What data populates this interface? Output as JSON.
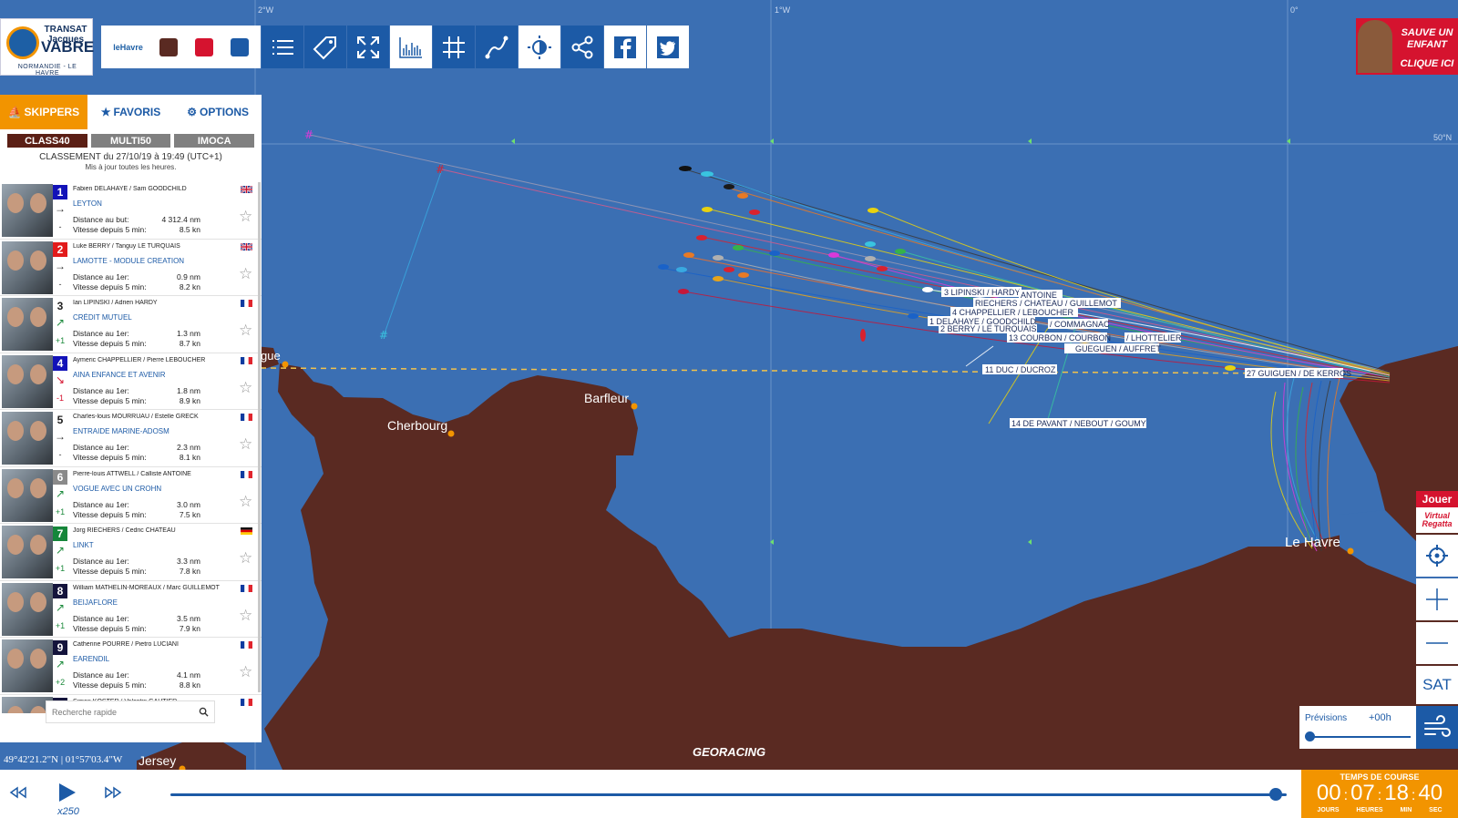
{
  "logo": {
    "line1": "TRANSAT Jacques",
    "line2": "VABRE",
    "line3": "NORMANDIE - LE HAVRE"
  },
  "partners": [
    "leHavre",
    "",
    "",
    ""
  ],
  "toolbar": [
    "list-icon",
    "tag-icon",
    "fullscreen-icon",
    "chart-icon",
    "grid-icon",
    "route-icon",
    "contrast-icon",
    "share-icon",
    "facebook-icon",
    "twitter-icon"
  ],
  "ad": {
    "line1": "SAUVE UN ENFANT",
    "line2": "CLIQUE ICI"
  },
  "panel": {
    "tabs": [
      "SKIPPERS",
      "FAVORIS",
      "OPTIONS"
    ],
    "classes": [
      "CLASS40",
      "MULTI50",
      "IMOCA"
    ],
    "ranking_title": "CLASSEMENT du 27/10/19 à 19:49 (UTC+1)",
    "ranking_sub": "Mis à jour toutes les heures.",
    "search_placeholder": "Recherche rapide"
  },
  "skippers": [
    {
      "rank": "1",
      "color": "#1212b8",
      "trend": "→",
      "delta": "-",
      "names": "Fabien DELAHAYE / Sam GOODCHILD",
      "boat": "LEYTON",
      "l1": "Distance au but:",
      "v1": "4 312.4 nm",
      "l2": "Vitesse depuis 5 min:",
      "v2": "8.5 kn",
      "flag": "gb"
    },
    {
      "rank": "2",
      "color": "#e21b1b",
      "trend": "→",
      "delta": "-",
      "names": "Luke BERRY / Tanguy LE TURQUAIS",
      "boat": "LAMOTTE - MODULE CREATION",
      "l1": "Distance au 1er:",
      "v1": "0.9 nm",
      "l2": "Vitesse depuis 5 min:",
      "v2": "8.2 kn",
      "flag": "gb"
    },
    {
      "rank": "3",
      "color": "#ffffff",
      "trend": "↗",
      "delta": "+1",
      "names": "Ian LIPINSKI / Adrien HARDY",
      "boat": "CRÉDIT MUTUEL",
      "l1": "Distance au 1er:",
      "v1": "1.3 nm",
      "l2": "Vitesse depuis 5 min:",
      "v2": "8.7 kn",
      "flag": "fr"
    },
    {
      "rank": "4",
      "color": "#1212b8",
      "trend": "↘",
      "delta": "-1",
      "names": "Aymeric CHAPPELLIER / Pierre LEBOUCHER",
      "boat": "AINA ENFANCE ET AVENIR",
      "l1": "Distance au 1er:",
      "v1": "1.8 nm",
      "l2": "Vitesse depuis 5 min:",
      "v2": "8.9 kn",
      "flag": "fr"
    },
    {
      "rank": "5",
      "color": "#ffffff",
      "trend": "→",
      "delta": "-",
      "names": "Charles-louis MOURRUAU / Estelle GRECK",
      "boat": "ENTRAIDE MARINE-ADOSM",
      "l1": "Distance au 1er:",
      "v1": "2.3 nm",
      "l2": "Vitesse depuis 5 min:",
      "v2": "8.1 kn",
      "flag": "fr"
    },
    {
      "rank": "6",
      "color": "#8a8a8a",
      "trend": "↗",
      "delta": "+1",
      "names": "Pierre-louis ATTWELL / Calliste ANTOINE",
      "boat": "VOGUE AVEC UN CROHN",
      "l1": "Distance au 1er:",
      "v1": "3.0 nm",
      "l2": "Vitesse depuis 5 min:",
      "v2": "7.5 kn",
      "flag": "fr"
    },
    {
      "rank": "7",
      "color": "#15863a",
      "trend": "↗",
      "delta": "+1",
      "names": "Jorg RIECHERS / Cedric CHATEAU",
      "boat": "LINKT",
      "l1": "Distance au 1er:",
      "v1": "3.3 nm",
      "l2": "Vitesse depuis 5 min:",
      "v2": "7.8 kn",
      "flag": "de"
    },
    {
      "rank": "8",
      "color": "#14143c",
      "trend": "↗",
      "delta": "+1",
      "names": "William MATHELIN-MOREAUX / Marc GUILLEMOT",
      "boat": "BEIJAFLORE",
      "l1": "Distance au 1er:",
      "v1": "3.5 nm",
      "l2": "Vitesse depuis 5 min:",
      "v2": "7.9 kn",
      "flag": "fr"
    },
    {
      "rank": "9",
      "color": "#14143c",
      "trend": "↗",
      "delta": "+2",
      "names": "Catherine POURRE / Pietro LUCIANI",
      "boat": "EARENDIL",
      "l1": "Distance au 1er:",
      "v1": "4.1 nm",
      "l2": "Vitesse depuis 5 min:",
      "v2": "8.8 kn",
      "flag": "fr"
    },
    {
      "rank": "10",
      "color": "#14143c",
      "trend": "",
      "delta": "",
      "names": "Simon KOSTER / Valentin GAUTIER",
      "boat": "",
      "l1": "",
      "v1": "",
      "l2": "",
      "v2": "",
      "flag": "fr"
    }
  ],
  "map": {
    "lon_labels": [
      "2°W",
      "1°W",
      "0°"
    ],
    "lat_label": "50°N",
    "places": [
      "Cherbourg",
      "Barfleur",
      "Le Havre",
      "Jersey",
      "gue"
    ],
    "watermark": "GEORACING",
    "boat_labels": [
      "3  LIPINSKI / HARDY",
      "ANTOINE",
      "RIECHERS / CHATEAU / GUILLEMOT",
      "4  CHAPPELLIER / LEBOUCHER",
      "1  DELAHAYE / GOODCHILD",
      "/ COMMAGNAC",
      "2  BERRY / LE TURQUAIS",
      "13  COURBON / COURBON",
      "/ LHOTTELIER",
      "GUEGUEN / AUFFRET",
      "11  DUC / DUCROZ",
      "27  GUIGUEN / DE KERROS",
      "14  DE PAVANT / NEBOUT / GOUMY"
    ]
  },
  "coords": "49°42'21.2\"N | 01°57'03.4\"W",
  "right_controls": {
    "jouer": "Jouer",
    "virtual_regatta": "Virtual Regatta",
    "sat": "SAT"
  },
  "forecast": {
    "label": "Prévisions",
    "value": "+00h"
  },
  "playback": {
    "speed": "x250",
    "progress": 0.99
  },
  "race_time": {
    "label": "TEMPS DE COURSE",
    "days": "00",
    "hours": "07",
    "minutes": "18",
    "seconds": "40",
    "units": [
      "JOURS",
      "HEURES",
      "MIN",
      "SEC"
    ]
  },
  "colors": {
    "sea": "#3b6fb3",
    "land": "#5a2a22",
    "accent": "#f29400",
    "primary": "#1c5aa6"
  }
}
